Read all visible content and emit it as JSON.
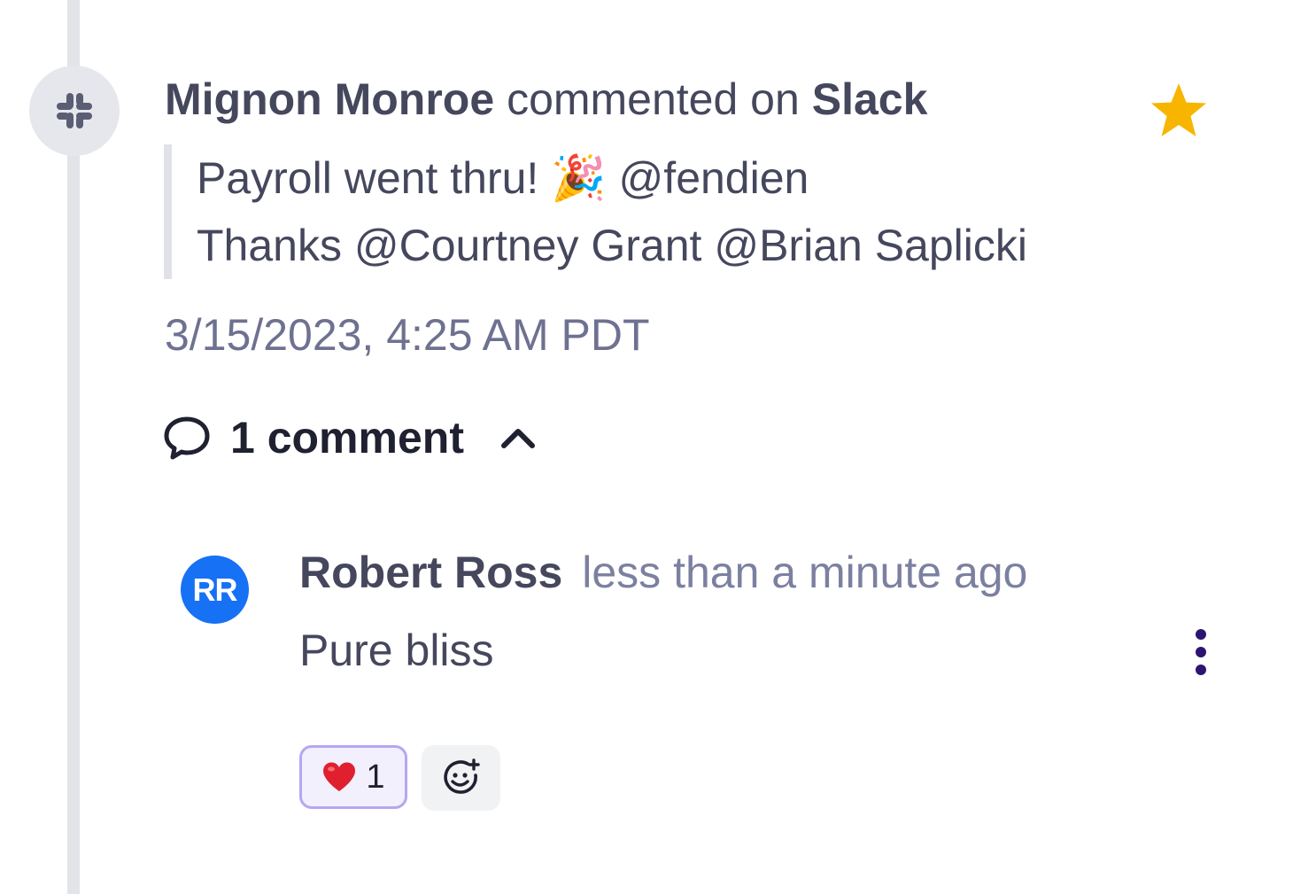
{
  "activity": {
    "source_icon": "slack-icon",
    "actor": "Mignon Monroe",
    "action": "commented on",
    "source": "Slack",
    "starred": true,
    "star_color": "#f7b500",
    "message_line1_text": "Payroll went thru!",
    "message_line1_emoji": "🎉",
    "message_line1_mention": "@fendien",
    "message_line2": "Thanks @Courtney Grant @Brian Saplicki",
    "timestamp": "3/15/2023, 4:25 AM PDT"
  },
  "comments": {
    "count_label": "1 comment",
    "toggle_icon": "chevron-up-icon",
    "items": [
      {
        "avatar_initials": "RR",
        "avatar_color": "#1671f5",
        "author": "Robert Ross",
        "time": "less than a minute ago",
        "text": "Pure bliss",
        "reactions": [
          {
            "emoji": "❤️",
            "count": "1"
          }
        ],
        "add_reaction_icon": "add-emoji-icon",
        "menu_icon": "more-vertical-icon"
      }
    ]
  },
  "colors": {
    "text_primary": "#45475d",
    "text_muted": "#6e7190",
    "menu_dots": "#2d1470",
    "reaction_border": "#b7a6f2"
  }
}
